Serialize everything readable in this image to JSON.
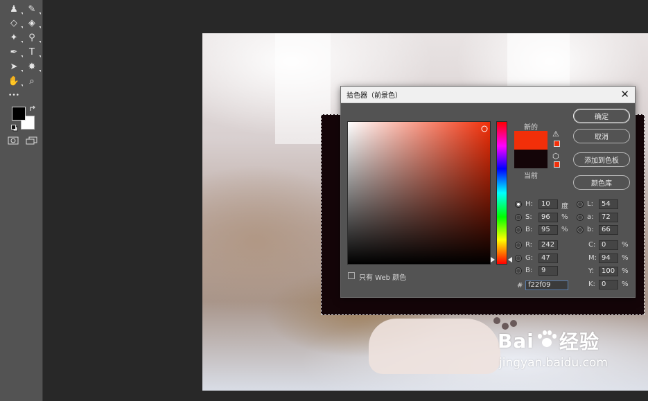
{
  "toolbar": {
    "tools": [
      {
        "name": "stamp-tool-icon",
        "glyph": "♟"
      },
      {
        "name": "history-brush-tool-icon",
        "glyph": "✎"
      },
      {
        "name": "eraser-tool-icon",
        "glyph": "◇"
      },
      {
        "name": "paint-bucket-tool-icon",
        "glyph": "◈"
      },
      {
        "name": "blur-tool-icon",
        "glyph": "✦"
      },
      {
        "name": "dodge-tool-icon",
        "glyph": "⚲"
      },
      {
        "name": "pen-tool-icon",
        "glyph": "✒"
      },
      {
        "name": "type-tool-icon",
        "glyph": "T"
      },
      {
        "name": "path-selection-tool-icon",
        "glyph": "➤"
      },
      {
        "name": "custom-shape-tool-icon",
        "glyph": "✸"
      },
      {
        "name": "hand-tool-icon",
        "glyph": "✋"
      },
      {
        "name": "zoom-tool-icon",
        "glyph": "⌕"
      },
      {
        "name": "more-tools-icon",
        "glyph": "•••"
      }
    ],
    "foreground_color": "#000000",
    "background_color": "#ffffff"
  },
  "dialog": {
    "title": "拾色器（前景色）",
    "new_label": "新的",
    "current_label": "当前",
    "new_color": "#f22f09",
    "current_color": "#140508",
    "buttons": {
      "ok": "确定",
      "cancel": "取消",
      "add_to_swatches": "添加到色板",
      "color_libraries": "颜色库"
    },
    "only_web_colors": "只有 Web 颜色",
    "hsb": {
      "h": "10",
      "s": "96",
      "b": "95",
      "h_unit": "度",
      "s_unit": "%",
      "b_unit": "%"
    },
    "rgb": {
      "r": "242",
      "g": "47",
      "b": "9"
    },
    "lab": {
      "l": "54",
      "a": "72",
      "b": "66"
    },
    "cmyk": {
      "c": "0",
      "m": "94",
      "y": "100",
      "k": "0",
      "unit": "%"
    },
    "hex": "f22f09",
    "labels": {
      "h": "H:",
      "s": "S:",
      "b": "B:",
      "r": "R:",
      "g": "G:",
      "bb": "B:",
      "l": "L:",
      "a": "a:",
      "lb": "b:",
      "c": "C:",
      "m": "M:",
      "y": "Y:",
      "k": "K:",
      "hash": "#"
    }
  },
  "watermark": {
    "logo_left": "Bai",
    "logo_right": "经验",
    "url": "jingyan.baidu.com"
  }
}
